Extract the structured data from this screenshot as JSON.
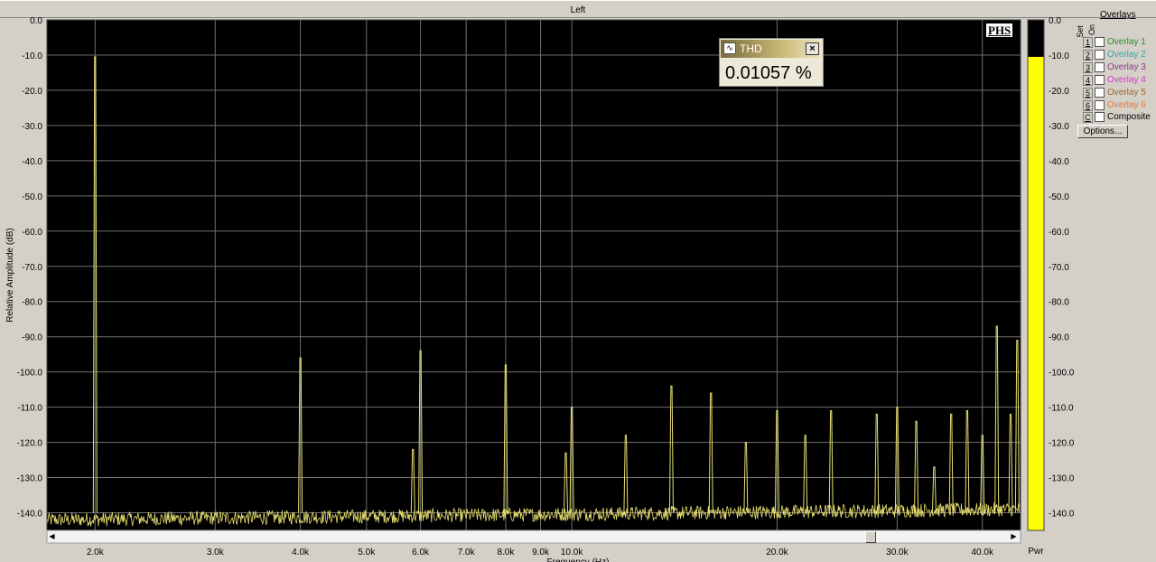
{
  "title": "Left",
  "badge": "PHS",
  "thd_window": {
    "title": "THD",
    "icon": "waveform-icon",
    "close_label": "×",
    "value": "0.01057 %"
  },
  "overlays": {
    "title": "Overlays",
    "set_label": "Set",
    "on_label": "On",
    "items": [
      {
        "key": "1",
        "label": "Overlay 1",
        "color": "#2e8b2e"
      },
      {
        "key": "2",
        "label": "Overlay 2",
        "color": "#33a8a8"
      },
      {
        "key": "3",
        "label": "Overlay 3",
        "color": "#8a3a8a"
      },
      {
        "key": "4",
        "label": "Overlay 4",
        "color": "#d23ad2"
      },
      {
        "key": "5",
        "label": "Overlay 5",
        "color": "#9a6a2a"
      },
      {
        "key": "6",
        "label": "Overlay 6",
        "color": "#e8743a"
      },
      {
        "key": "C",
        "label": "Composite",
        "color": "#000000"
      }
    ],
    "options_label": "Options..."
  },
  "chart_data": {
    "type": "line",
    "xlabel": "Frequency (Hz)",
    "ylabel": "Relative Amplitude (dB)",
    "x_scale": "log",
    "xlim": [
      1700,
      45500
    ],
    "ylim": [
      -145,
      0
    ],
    "grid": true,
    "background": "#000000",
    "line_color": "#e8e070",
    "x_ticks": [
      {
        "value": 2000,
        "label": "2.0k"
      },
      {
        "value": 3000,
        "label": "3.0k"
      },
      {
        "value": 4000,
        "label": "4.0k"
      },
      {
        "value": 5000,
        "label": "5.0k"
      },
      {
        "value": 6000,
        "label": "6.0k"
      },
      {
        "value": 7000,
        "label": "7.0k"
      },
      {
        "value": 8000,
        "label": "8.0k"
      },
      {
        "value": 9000,
        "label": "9.0k"
      },
      {
        "value": 10000,
        "label": "10.0k"
      },
      {
        "value": 20000,
        "label": "20.0k"
      },
      {
        "value": 30000,
        "label": "30.0k"
      },
      {
        "value": 40000,
        "label": "40.0k"
      }
    ],
    "y_ticks": [
      0,
      -10,
      -20,
      -30,
      -40,
      -50,
      -60,
      -70,
      -80,
      -90,
      -100,
      -110,
      -120,
      -130,
      -140
    ],
    "y_tick_labels": [
      "0.0",
      "-10.0",
      "-20.0",
      "-30.0",
      "-40.0",
      "-50.0",
      "-60.0",
      "-70.0",
      "-80.0",
      "-90.0",
      "-100.0",
      "-110.0",
      "-120.0",
      "-130.0",
      "-140.0"
    ],
    "noise_floor_db": -140,
    "peaks": [
      {
        "freq": 2000,
        "db": -10.5
      },
      {
        "freq": 4000,
        "db": -96
      },
      {
        "freq": 5850,
        "db": -122
      },
      {
        "freq": 6000,
        "db": -94
      },
      {
        "freq": 8000,
        "db": -98
      },
      {
        "freq": 9800,
        "db": -123
      },
      {
        "freq": 10000,
        "db": -110
      },
      {
        "freq": 12000,
        "db": -118
      },
      {
        "freq": 14000,
        "db": -104
      },
      {
        "freq": 16000,
        "db": -106
      },
      {
        "freq": 18000,
        "db": -120
      },
      {
        "freq": 20000,
        "db": -111
      },
      {
        "freq": 22000,
        "db": -118
      },
      {
        "freq": 24000,
        "db": -111
      },
      {
        "freq": 28000,
        "db": -112
      },
      {
        "freq": 30000,
        "db": -110
      },
      {
        "freq": 32000,
        "db": -114
      },
      {
        "freq": 34000,
        "db": -127
      },
      {
        "freq": 36000,
        "db": -112
      },
      {
        "freq": 38000,
        "db": -111
      },
      {
        "freq": 40000,
        "db": -118
      },
      {
        "freq": 42000,
        "db": -87
      },
      {
        "freq": 44000,
        "db": -112
      },
      {
        "freq": 45000,
        "db": -91
      }
    ],
    "power_meter": {
      "label": "Pwr",
      "level_db": -10.5,
      "ticks": [
        "0.0",
        "-10.0",
        "-20.0",
        "-30.0",
        "-40.0",
        "-50.0",
        "-60.0",
        "-70.0",
        "-80.0",
        "-90.0",
        "-100.0",
        "-110.0",
        "-120.0",
        "-130.0",
        "-140.0"
      ],
      "color": "#ffff00"
    }
  }
}
